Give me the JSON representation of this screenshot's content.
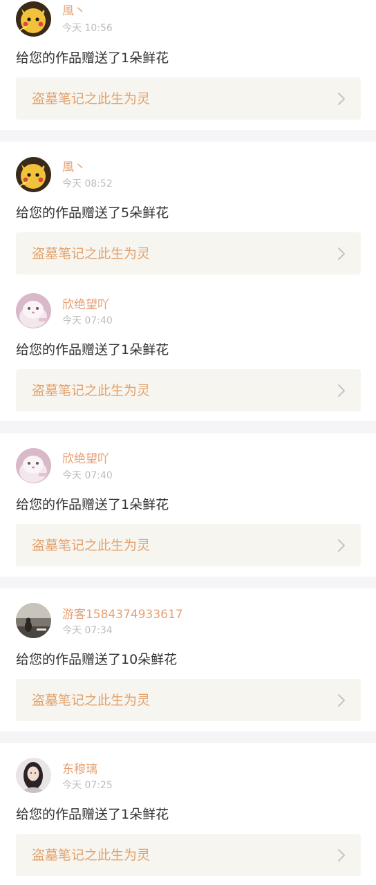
{
  "colors": {
    "accent": "#e3a16b",
    "username": "#e5a074",
    "timestamp": "#bdbdbd",
    "message": "#333333",
    "link_background": "#f6f5ef",
    "separator": "#f5f5f7"
  },
  "notifications": [
    {
      "avatar": "pikachu-avatar",
      "username": "風丶",
      "time": "今天 10:56",
      "message": "给您的作品赠送了1朵鲜花",
      "work_title": "盗墓笔记之此生为灵",
      "chevron": "chevron-right-icon"
    },
    {
      "avatar": "pikachu-avatar",
      "username": "風丶",
      "time": "今天 08:52",
      "message": "给您的作品赠送了5朵鲜花",
      "work_title": "盗墓笔记之此生为灵",
      "chevron": "chevron-right-icon"
    },
    {
      "avatar": "cat-avatar",
      "username": "欣绝望吖",
      "time": "今天 07:40",
      "message": "给您的作品赠送了1朵鲜花",
      "work_title": "盗墓笔记之此生为灵",
      "chevron": "chevron-right-icon"
    },
    {
      "avatar": "cat-avatar",
      "username": "欣绝望吖",
      "time": "今天 07:40",
      "message": "给您的作品赠送了1朵鲜花",
      "work_title": "盗墓笔记之此生为灵",
      "chevron": "chevron-right-icon"
    },
    {
      "avatar": "landscape-avatar",
      "username": "游客1584374933617",
      "time": "今天 07:34",
      "message": "给您的作品赠送了10朵鲜花",
      "work_title": "盗墓笔记之此生为灵",
      "chevron": "chevron-right-icon"
    },
    {
      "avatar": "portrait-avatar",
      "username": "东穆璃",
      "time": "今天 07:25",
      "message": "给您的作品赠送了1朵鲜花",
      "work_title": "盗墓笔记之此生为灵",
      "chevron": "chevron-right-icon"
    }
  ]
}
